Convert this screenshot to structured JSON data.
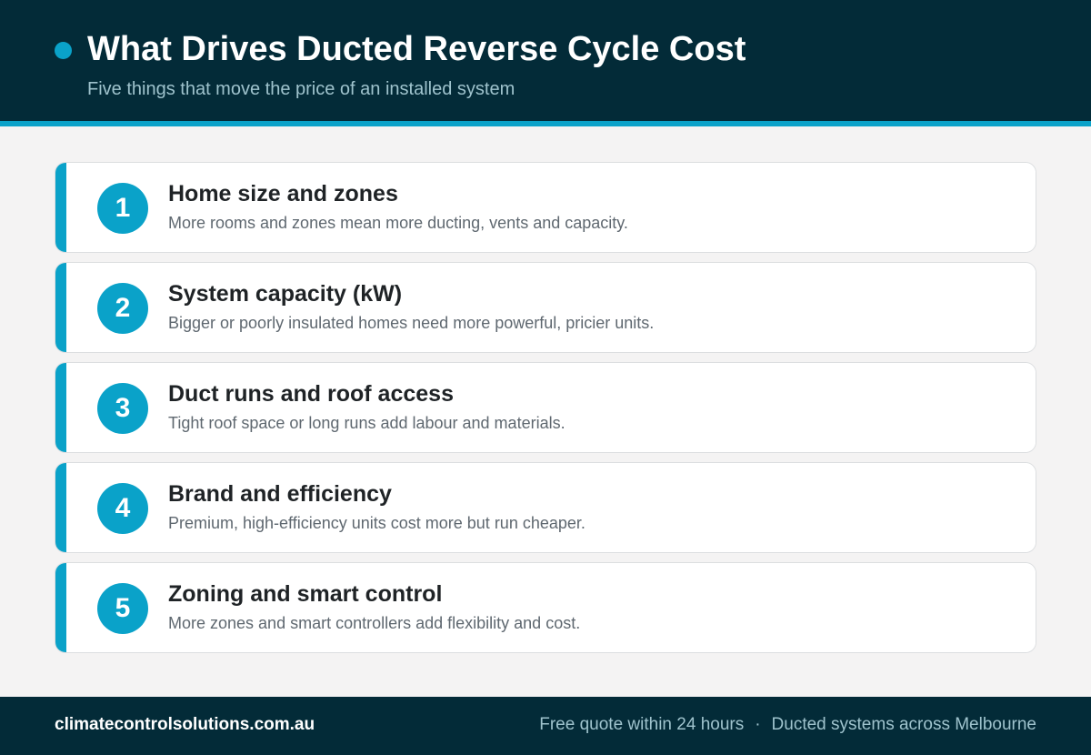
{
  "header": {
    "title": "What Drives Ducted Reverse Cycle Cost",
    "subtitle": "Five things that move the price of an installed system"
  },
  "colors": {
    "dark": "#032b38",
    "accent": "#0aa2c9",
    "background": "#f4f3f3"
  },
  "factors": [
    {
      "number": "1",
      "title": "Home size and zones",
      "description": "More rooms and zones mean more ducting, vents and capacity."
    },
    {
      "number": "2",
      "title": "System capacity (kW)",
      "description": "Bigger or poorly insulated homes need more powerful, pricier units."
    },
    {
      "number": "3",
      "title": "Duct runs and roof access",
      "description": "Tight roof space or long runs add labour and materials."
    },
    {
      "number": "4",
      "title": "Brand and efficiency",
      "description": "Premium, high-efficiency units cost more but run cheaper."
    },
    {
      "number": "5",
      "title": "Zoning and smart control",
      "description": "More zones and smart controllers add flexibility and cost."
    }
  ],
  "footer": {
    "website": "climatecontrolsolutions.com.au",
    "tagline_1": "Free quote within 24 hours",
    "separator": "·",
    "tagline_2": "Ducted systems across Melbourne"
  }
}
